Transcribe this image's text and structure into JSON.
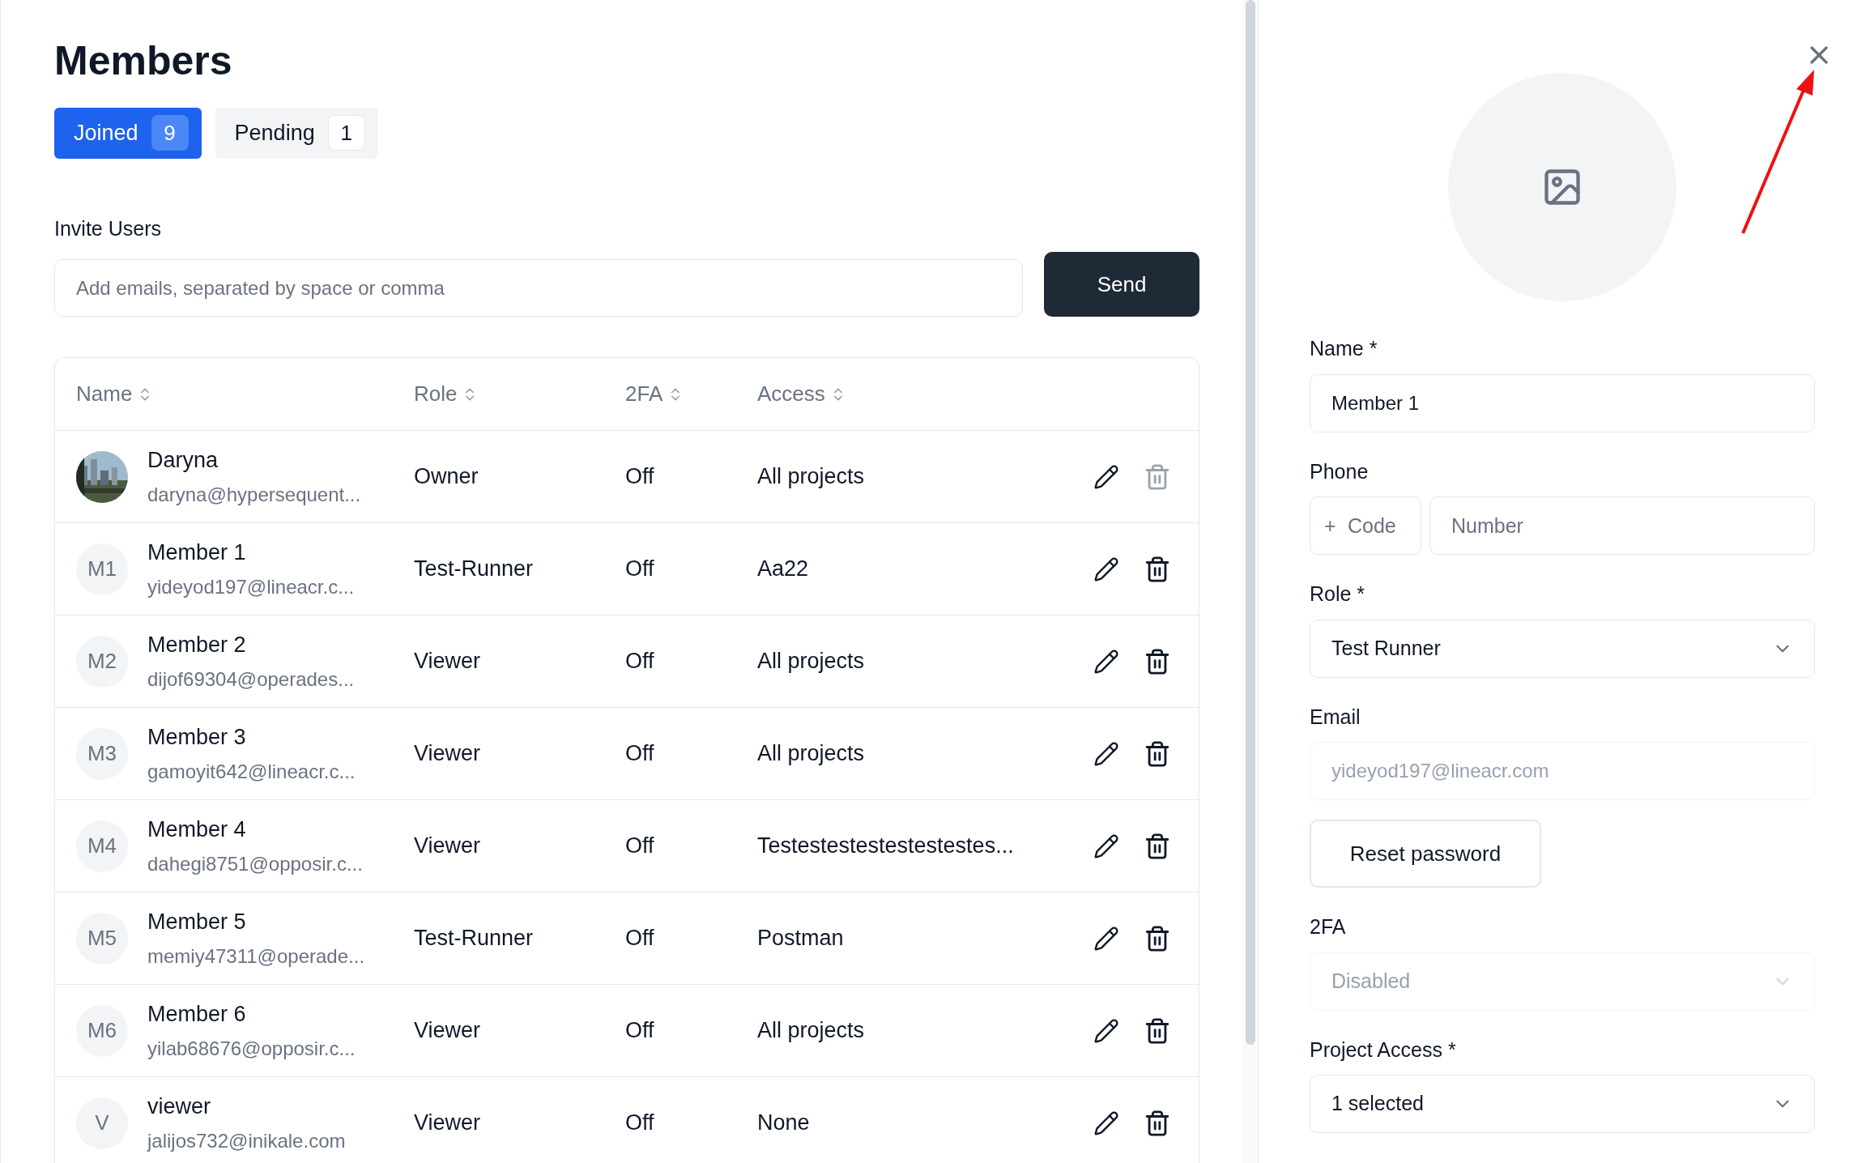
{
  "title": "Members",
  "tabs": [
    {
      "label": "Joined",
      "count": "9",
      "selected": true
    },
    {
      "label": "Pending",
      "count": "1",
      "selected": false
    }
  ],
  "invite": {
    "label": "Invite Users",
    "placeholder": "Add emails, separated by space or comma",
    "button": "Send"
  },
  "table": {
    "columns": [
      "Name",
      "Role",
      "2FA",
      "Access"
    ],
    "rows": [
      {
        "name": "Daryna",
        "email": "daryna@hypersequent...",
        "role": "Owner",
        "twofa": "Off",
        "access": "All projects",
        "delete_disabled": true
      },
      {
        "avatar": {
          "kind": "initials",
          "text": "M1"
        },
        "name": "Member 1",
        "email": "yideyod197@lineacr.c...",
        "role": "Test-Runner",
        "twofa": "Off",
        "access": "Aa22",
        "delete_disabled": false
      },
      {
        "avatar": {
          "kind": "initials",
          "text": "M2"
        },
        "name": "Member 2",
        "email": "dijof69304@operades...",
        "role": "Viewer",
        "twofa": "Off",
        "access": "All projects",
        "delete_disabled": false
      },
      {
        "avatar": {
          "kind": "initials",
          "text": "M3"
        },
        "name": "Member 3",
        "email": "gamoyit642@lineacr.c...",
        "role": "Viewer",
        "twofa": "Off",
        "access": "All projects",
        "delete_disabled": false
      },
      {
        "avatar": {
          "kind": "initials",
          "text": "M4"
        },
        "name": "Member 4",
        "email": "dahegi8751@opposir.c...",
        "role": "Viewer",
        "twofa": "Off",
        "access": "Testestestestestestestes...",
        "delete_disabled": false
      },
      {
        "avatar": {
          "kind": "initials",
          "text": "M5"
        },
        "name": "Member 5",
        "email": "memiy47311@operade...",
        "role": "Test-Runner",
        "twofa": "Off",
        "access": "Postman",
        "delete_disabled": false
      },
      {
        "avatar": {
          "kind": "initials",
          "text": "M6"
        },
        "name": "Member 6",
        "email": "yilab68676@opposir.c...",
        "role": "Viewer",
        "twofa": "Off",
        "access": "All projects",
        "delete_disabled": false
      },
      {
        "avatar": {
          "kind": "initials",
          "text": "V"
        },
        "name": "viewer",
        "email": "jalijos732@inikale.com",
        "role": "Viewer",
        "twofa": "Off",
        "access": "None",
        "delete_disabled": false
      }
    ]
  },
  "panel": {
    "name": {
      "label": "Name *",
      "value": "Member 1"
    },
    "phone": {
      "label": "Phone",
      "prefix": "+",
      "code_placeholder": "Code",
      "number_placeholder": "Number"
    },
    "role": {
      "label": "Role *",
      "value": "Test Runner",
      "disabled": false
    },
    "email": {
      "label": "Email",
      "value": "yideyod197@lineacr.com",
      "disabled": true
    },
    "reset_button": "Reset password",
    "twofa": {
      "label": "2FA",
      "value": "Disabled",
      "disabled": true
    },
    "project_access": {
      "label": "Project Access *",
      "value": "1 selected",
      "disabled": false
    }
  }
}
